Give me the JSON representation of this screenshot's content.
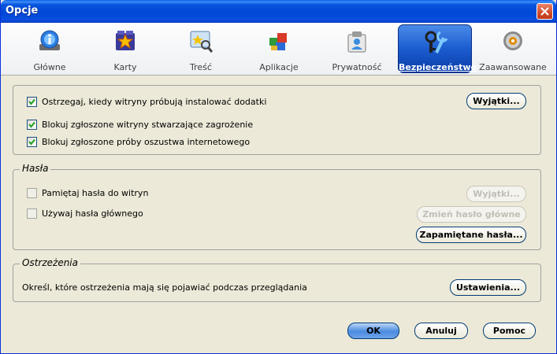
{
  "window": {
    "title": "Opcje"
  },
  "tabs": [
    {
      "label": "Główne",
      "icon": "general-icon"
    },
    {
      "label": "Karty",
      "icon": "tabs-icon"
    },
    {
      "label": "Treść",
      "icon": "content-icon"
    },
    {
      "label": "Aplikacje",
      "icon": "applications-icon"
    },
    {
      "label": "Prywatność",
      "icon": "privacy-icon"
    },
    {
      "label": "Bezpieczeństwo",
      "icon": "security-icon",
      "selected": true
    },
    {
      "label": "Zaawansowane",
      "icon": "advanced-icon"
    }
  ],
  "addons": {
    "warn": {
      "label": "Ostrzegaj, kiedy witryny próbują instalować dodatki",
      "checked": true
    },
    "exceptions_button": "Wyjątki...",
    "block_attack": {
      "label": "Blokuj zgłoszone witryny stwarzające zagrożenie",
      "checked": true
    },
    "block_forgery": {
      "label": "Blokuj zgłoszone próby oszustwa internetowego",
      "checked": true
    }
  },
  "passwords": {
    "title": "Hasła",
    "remember": {
      "label": "Pamiętaj hasła do witryn",
      "checked": false
    },
    "exceptions_button": "Wyjątki...",
    "master": {
      "label": "Używaj hasła głównego",
      "checked": false
    },
    "change_master_button": "Zmień hasło główne",
    "saved_button": "Zapamiętane hasła..."
  },
  "warnings": {
    "title": "Ostrzeżenia",
    "description": "Określ, które ostrzeżenia mają się pojawiać podczas przeglądania",
    "settings_button": "Ustawienia..."
  },
  "footer": {
    "ok": "OK",
    "cancel": "Anuluj",
    "help": "Pomoc"
  },
  "colors": {
    "selected_tab": "#1c5ccf",
    "titlebar": "#0047d6",
    "dialog_bg": "#ece9d8"
  }
}
